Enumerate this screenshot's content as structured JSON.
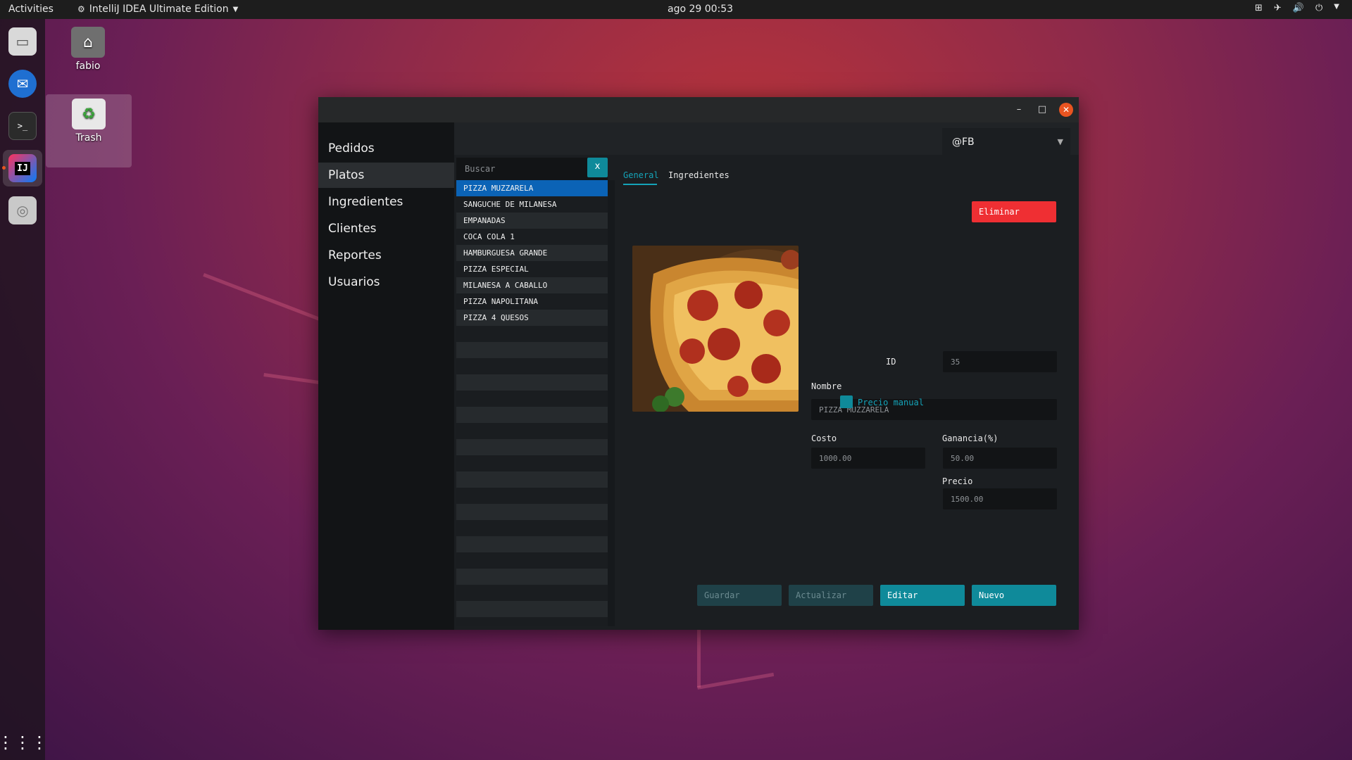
{
  "topbar": {
    "activities": "Activities",
    "app_menu": "IntelliJ IDEA Ultimate Edition",
    "clock": "ago 29  00:53"
  },
  "desktop": {
    "icons": [
      {
        "label": "fabio",
        "icon": "home-folder-icon"
      },
      {
        "label": "Trash",
        "icon": "trash-icon"
      }
    ]
  },
  "dock": {
    "apps": [
      "files-icon",
      "thunderbird-icon",
      "terminal-icon",
      "intellij-icon",
      "disk-icon"
    ],
    "show_apps_icon": "grid-icon"
  },
  "window": {
    "user": "@FB",
    "sidebar": {
      "items": [
        {
          "label": "Pedidos"
        },
        {
          "label": "Platos"
        },
        {
          "label": "Ingredientes"
        },
        {
          "label": "Clientes"
        },
        {
          "label": "Reportes"
        },
        {
          "label": "Usuarios"
        }
      ],
      "active_index": 1
    },
    "search": {
      "placeholder": "Buscar",
      "clear_label": "x"
    },
    "list": {
      "items": [
        "PIZZA MUZZARELA",
        "SANGUCHE DE MILANESA",
        "EMPANADAS",
        "COCA COLA 1",
        "HAMBURGUESA GRANDE",
        "PIZZA ESPECIAL",
        "MILANESA A CABALLO",
        "PIZZA NAPOLITANA",
        "PIZZA 4 QUESOS"
      ],
      "selected_index": 0
    },
    "tabs": {
      "general": "General",
      "ingredientes": "Ingredientes"
    },
    "form": {
      "delete_label": "Eliminar",
      "id_label": "ID",
      "id_value": "35",
      "nombre_label": "Nombre",
      "nombre_value": "PIZZA MUZZARELA",
      "costo_label": "Costo",
      "costo_value": "1000.00",
      "ganancia_label": "Ganancia(%)",
      "ganancia_value": "50.00",
      "precio_label": "Precio",
      "precio_value": "1500.00",
      "precio_manual_label": "Precio manual"
    },
    "actions": {
      "guardar": "Guardar",
      "actualizar": "Actualizar",
      "editar": "Editar",
      "nuevo": "Nuevo"
    },
    "colors": {
      "accent": "#0f8a9a",
      "danger": "#ef2f33",
      "selection": "#0b63b6"
    }
  }
}
